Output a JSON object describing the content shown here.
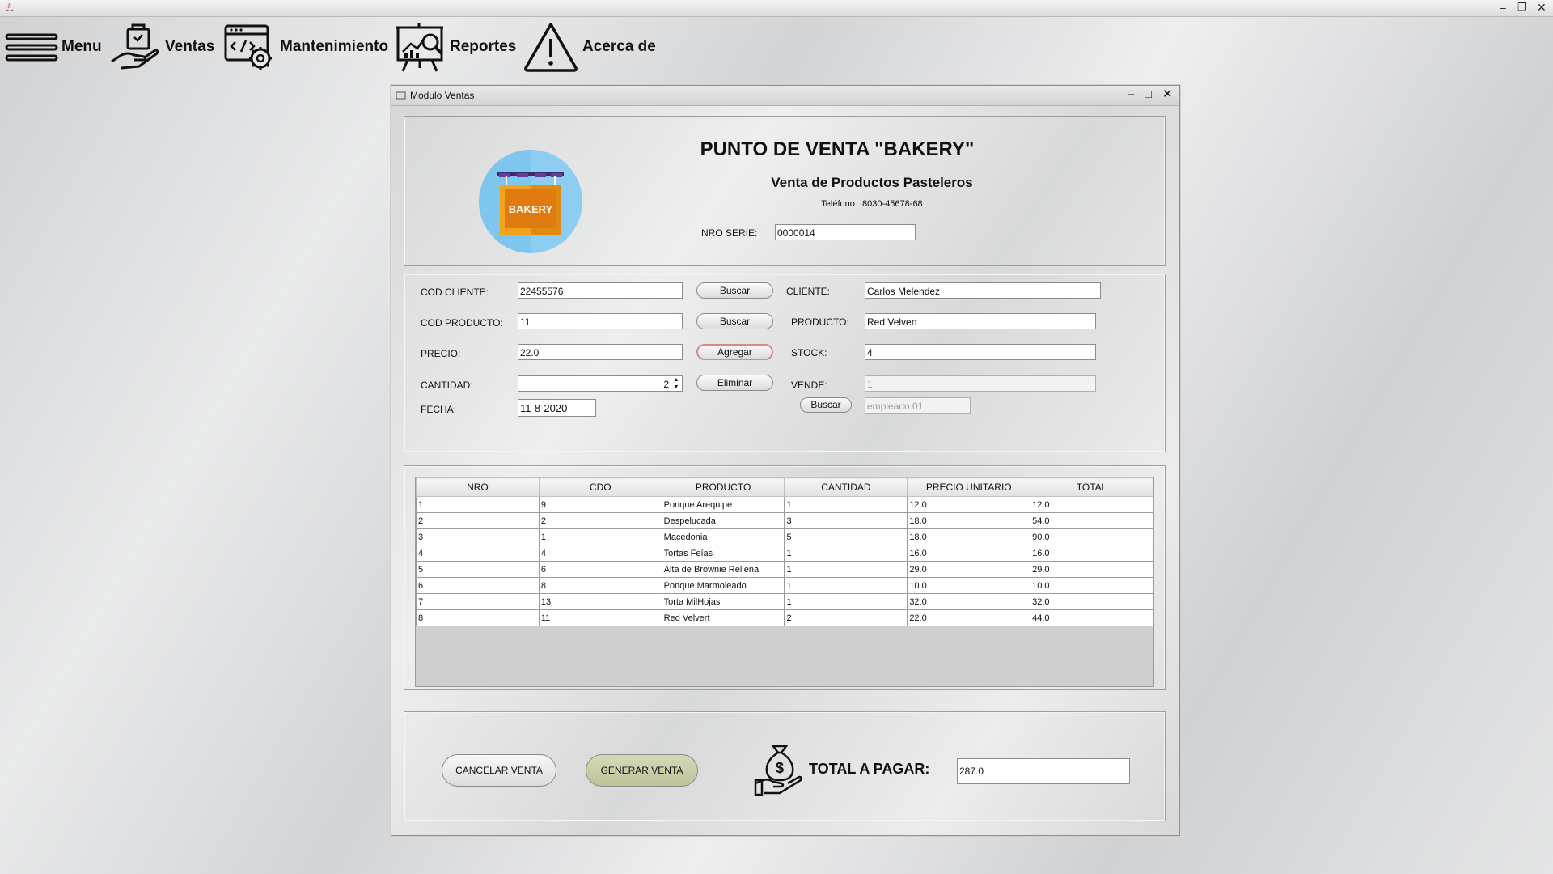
{
  "menu": {
    "items": [
      {
        "label": "Menu",
        "icon": "hamburger-icon"
      },
      {
        "label": "Ventas",
        "icon": "hand-bag-icon"
      },
      {
        "label": "Mantenimiento",
        "icon": "code-gear-icon"
      },
      {
        "label": "Reportes",
        "icon": "chart-board-icon"
      },
      {
        "label": "Acerca de",
        "icon": "warning-icon"
      }
    ]
  },
  "window": {
    "title": "Modulo Ventas",
    "controls": {
      "minimize": "–",
      "maximize": "□",
      "close": "✕"
    }
  },
  "header": {
    "title": "PUNTO DE VENTA \"BAKERY\"",
    "subtitle": "Venta de Productos Pasteleros",
    "phone": "Teléfono : 8030-45678-68",
    "serie_label": "NRO SERIE:",
    "serie_value": "0000014",
    "logo_text": "BAKERY"
  },
  "form": {
    "cod_cliente_label": "COD CLIENTE:",
    "cod_cliente_value": "22455576",
    "cod_producto_label": "COD PRODUCTO:",
    "cod_producto_value": "11",
    "precio_label": "PRECIO:",
    "precio_value": "22.0",
    "cantidad_label": "CANTIDAD:",
    "cantidad_value": "2",
    "fecha_label": "FECHA:",
    "fecha_value": "11-8-2020",
    "buscar_label": "Buscar",
    "agregar_label": "Agregar",
    "eliminar_label": "Eliminar",
    "cliente_label": "CLIENTE:",
    "cliente_value": "Carlos Melendez",
    "producto_label": "PRODUCTO:",
    "producto_value": "Red Velvert",
    "stock_label": "STOCK:",
    "stock_value": "4",
    "vende_label": "VENDE:",
    "vende_value": "1",
    "empleado_value": "empleado 01"
  },
  "table": {
    "headers": [
      "NRO",
      "CDO",
      "PRODUCTO",
      "CANTIDAD",
      "PRECIO UNITARIO",
      "TOTAL"
    ],
    "rows": [
      [
        "1",
        "9",
        "Ponque Arequipe",
        "1",
        "12.0",
        "12.0"
      ],
      [
        "2",
        "2",
        "Despelucada",
        "3",
        "18.0",
        "54.0"
      ],
      [
        "3",
        "1",
        "Macedonia",
        "5",
        "18.0",
        "90.0"
      ],
      [
        "4",
        "4",
        "Tortas Feías",
        "1",
        "16.0",
        "16.0"
      ],
      [
        "5",
        "6",
        "Alta de Brownie Rellena",
        "1",
        "29.0",
        "29.0"
      ],
      [
        "6",
        "8",
        "Ponque Marmoleado",
        "1",
        "10.0",
        "10.0"
      ],
      [
        "7",
        "13",
        "Torta MilHojas",
        "1",
        "32.0",
        "32.0"
      ],
      [
        "8",
        "11",
        "Red Velvert",
        "2",
        "22.0",
        "44.0"
      ]
    ]
  },
  "footer": {
    "cancel_label": "CANCELAR VENTA",
    "generate_label": "GENERAR VENTA",
    "total_label": "TOTAL A PAGAR:",
    "total_value": "287.0"
  },
  "colors": {
    "generate_button": "#c8cca4",
    "logo_circle": "#7fc6ee",
    "logo_box": "#f2a31b",
    "logo_accent": "#6b3aa0"
  }
}
